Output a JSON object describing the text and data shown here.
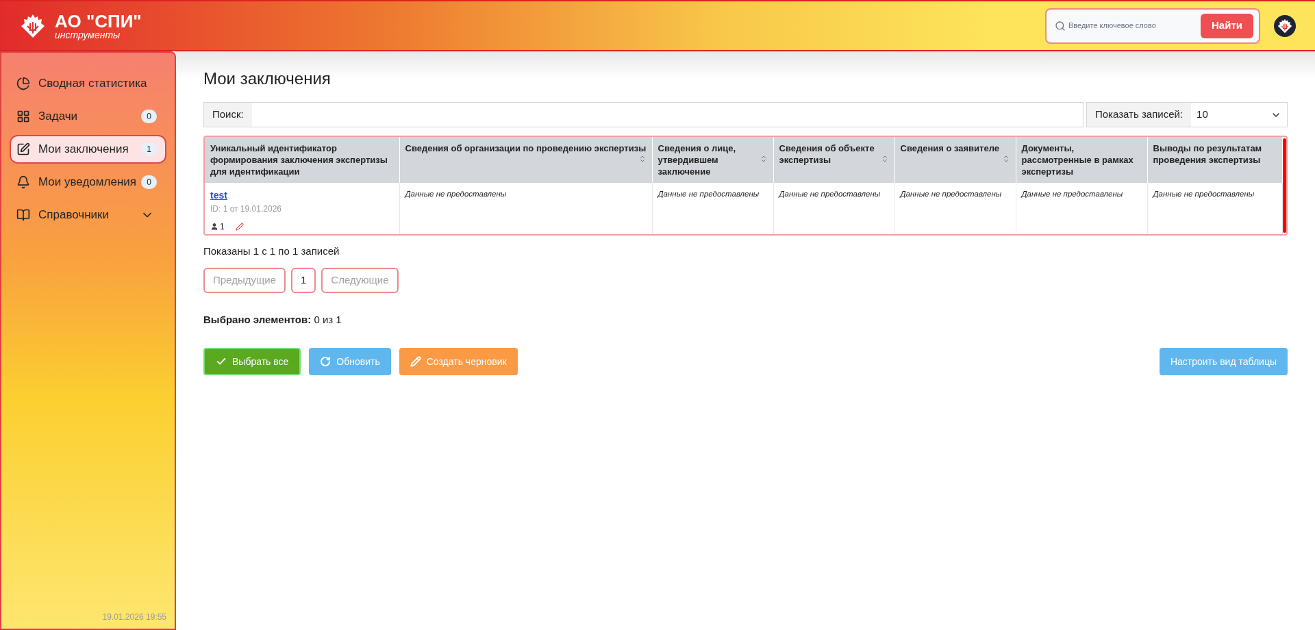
{
  "header": {
    "brand": "АО \"СПИ\"",
    "subtitle": "инструменты",
    "search": {
      "placeholder": "Введите ключевое слово",
      "button": "Найти"
    }
  },
  "sidebar": {
    "items": [
      {
        "label": "Сводная статистика",
        "selected": false
      },
      {
        "label": "Задачи",
        "badge": "0",
        "selected": false
      },
      {
        "label": "Мои заключения",
        "badge": "1",
        "selected": true
      },
      {
        "label": "Мои уведомления",
        "badge": "0",
        "selected": false
      },
      {
        "label": "Справочники",
        "expanded": false,
        "selected": false
      }
    ],
    "timestamp": "19.01.2026 19:55"
  },
  "page": {
    "title": "Мои заключения",
    "search_label": "Поиск:",
    "page_size_label": "Показать записей:",
    "page_size": "10"
  },
  "table": {
    "columns": [
      {
        "label": "Уникальный идентификатор формирования заключения экспертизы для идентификации",
        "sortable": false
      },
      {
        "label": "Сведения об организации по проведению экспертизы",
        "sortable": true
      },
      {
        "label": "Сведения о лице, утвердившем заключение",
        "sortable": true
      },
      {
        "label": "Сведения об объекте экспертизы",
        "sortable": true
      },
      {
        "label": "Сведения о заявителе",
        "sortable": true
      },
      {
        "label": "Документы, рассмотренные в рамках экспертизы",
        "sortable": false
      },
      {
        "label": "Выводы по результатам проведения экспертизы",
        "sortable": false
      }
    ],
    "rows": [
      {
        "cells": [
          {
            "link": "test",
            "meta": "ID: 1 от 19.01.2026",
            "count": "1"
          },
          "Данные не предоставлены",
          "Данные не предоставлены",
          "Данные не предоставлены",
          "Данные не предоставлены",
          "Данные не предоставлены",
          "Данные не предоставлены"
        ]
      }
    ]
  },
  "info": "Показаны 1 с 1 по 1 записей",
  "pagination": [
    {
      "label": "Предыдущие",
      "disabled": true
    },
    {
      "label": "1",
      "disabled": false
    },
    {
      "label": "Следующие",
      "disabled": true
    }
  ],
  "selection": "**Выбрано элементов:** 0 из 1",
  "actions": [
    {
      "label": "Выбрать все",
      "kind": "select"
    },
    {
      "label": "Обновить",
      "kind": "refresh"
    },
    {
      "label": "Создать черновик",
      "kind": "draft"
    }
  ],
  "table_settings": "Настроить вид таблицы"
}
